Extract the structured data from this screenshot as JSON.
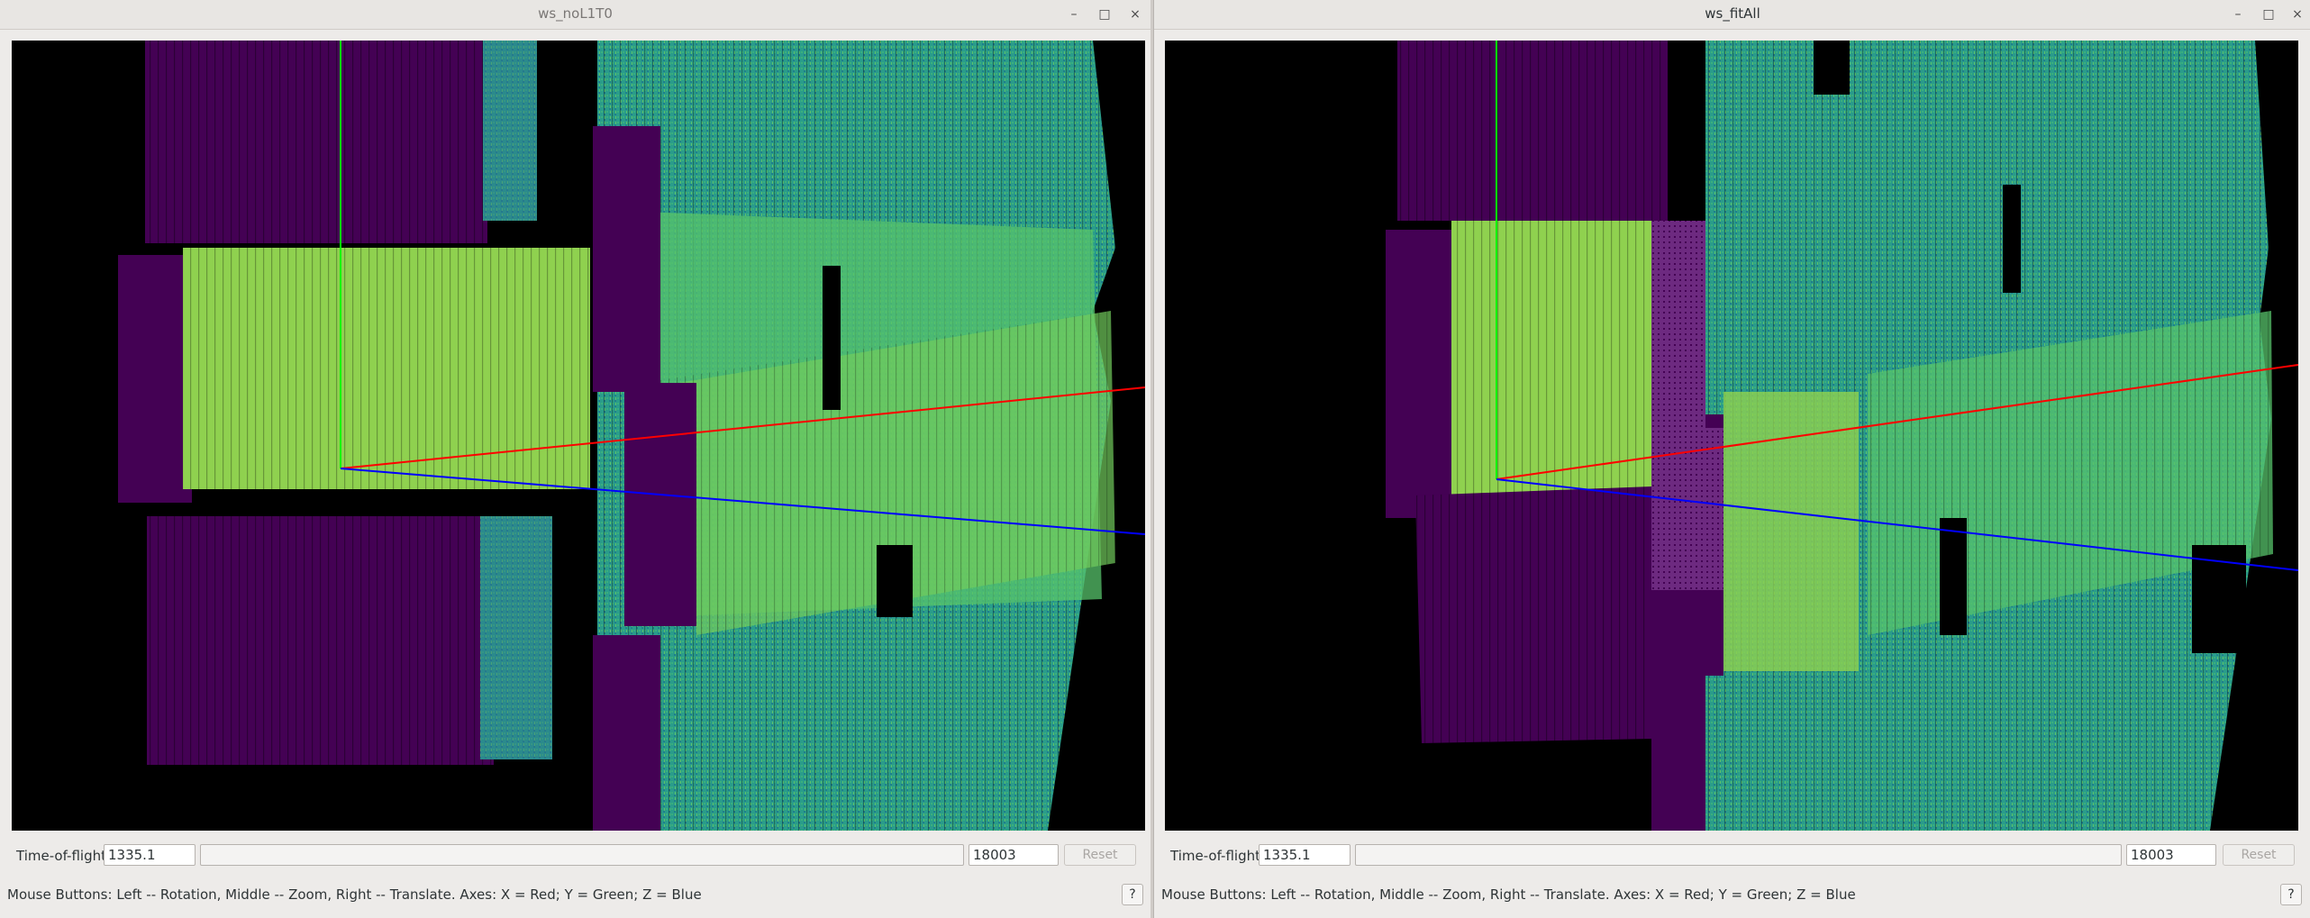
{
  "left": {
    "title": "ws_noL1T0",
    "tof_label": "Time-of-flight",
    "tof_min": "1335.1",
    "tof_max": "18003",
    "reset_label": "Reset",
    "status": "Mouse Buttons: Left -- Rotation, Middle -- Zoom, Right -- Translate. Axes: X = Red; Y = Green; Z = Blue",
    "help_label": "?"
  },
  "right": {
    "title": "ws_fitAll",
    "tof_label": "Time-of-flight",
    "tof_min": "1335.1",
    "tof_max": "18003",
    "reset_label": "Reset",
    "status": "Mouse Buttons: Left -- Rotation, Middle -- Zoom, Right -- Translate. Axes: X = Red; Y = Green; Z = Blue",
    "help_label": "?"
  },
  "window_controls": {
    "minimize": "–",
    "maximize": "□",
    "close": "×"
  },
  "colors": {
    "purple": "#440154",
    "teal": "#21918c",
    "green": "#35b779",
    "lightgreen": "#8fd14f",
    "x_axis": "#ff0000",
    "y_axis": "#00ff00",
    "z_axis": "#0000ff"
  }
}
